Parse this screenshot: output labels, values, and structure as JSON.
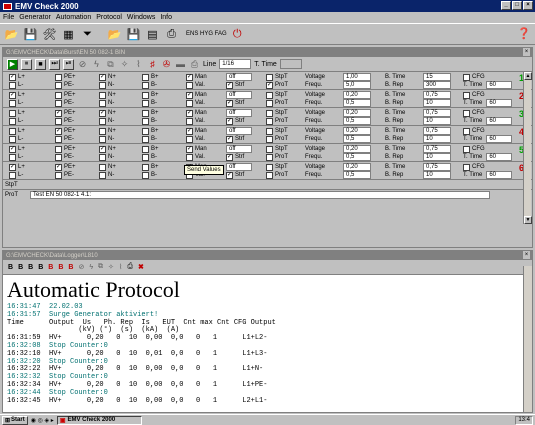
{
  "window": {
    "title": "EMV Check 2000",
    "min": "_",
    "max": "□",
    "close": "×"
  },
  "menu": [
    "File",
    "Generator",
    "Automation",
    "Protocol",
    "Windows",
    "Info"
  ],
  "toolbar": {
    "ins_label": "ENS HYG FAG"
  },
  "panel1": {
    "title": "G:\\EMVCHECK\\Data\\Burst\\EN 50 082-1 BIN",
    "line_label": "Line",
    "line_value": "1/16",
    "ttime_label": "T. Time",
    "rows": [
      {
        "num": "1",
        "num_color": "#00a000",
        "top": {
          "L": "L+",
          "PE": "PE+",
          "N": "N+",
          "B": "B+",
          "mode_lbl": "Man",
          "mode_val": "off",
          "stp": "StpT",
          "v_lbl": "Voltage",
          "v_val": "1,00",
          "bt_lbl": "B. Time",
          "bt_val": "15",
          "cfg": "CFG"
        },
        "bot": {
          "L": "L-",
          "PE": "PE-",
          "N": "N-",
          "B": "B-",
          "val": "Val.",
          "str": "Strf",
          "prot": "ProT",
          "f_lbl": "Frequ.",
          "f_val": "5,0",
          "br_lbl": "B. Rep",
          "br_val": "300",
          "tt_lbl": "T. Time",
          "tt_val": "60"
        },
        "checks": {
          "Lt": true,
          "PEt": false,
          "Nt": true,
          "Bt": false,
          "Man": true,
          "Stp": false,
          "CFG": false,
          "Lb": false,
          "PEb": false,
          "Nb": false,
          "Bb": false,
          "Val": false,
          "Str": true,
          "Prot": true
        }
      },
      {
        "num": "2",
        "num_color": "#c00000",
        "top": {
          "L": "L+",
          "PE": "PE+",
          "N": "N+",
          "B": "B+",
          "mode_lbl": "Man",
          "mode_val": "off",
          "stp": "StpT",
          "v_lbl": "Voltage",
          "v_val": "0,20",
          "bt_lbl": "B. Time",
          "bt_val": "0,75",
          "cfg": "CFG"
        },
        "bot": {
          "L": "L-",
          "PE": "PE-",
          "N": "N-",
          "B": "B-",
          "val": "Val.",
          "str": "Strf",
          "prot": "ProT",
          "f_lbl": "Frequ.",
          "f_val": "0,5",
          "br_lbl": "B. Rep",
          "br_val": "10",
          "tt_lbl": "T. Time",
          "tt_val": "60"
        },
        "checks": {
          "Lt": true,
          "PEt": false,
          "Nt": false,
          "Bt": false,
          "Man": true,
          "Stp": false,
          "CFG": false,
          "Lb": false,
          "PEb": false,
          "Nb": false,
          "Bb": false,
          "Val": false,
          "Str": true,
          "Prot": false
        }
      },
      {
        "num": "3",
        "num_color": "#00a000",
        "top": {
          "L": "L+",
          "PE": "PE+",
          "N": "N+",
          "B": "B+",
          "mode_lbl": "Man",
          "mode_val": "off",
          "stp": "StpT",
          "v_lbl": "Voltage",
          "v_val": "0,20",
          "bt_lbl": "B. Time",
          "bt_val": "0,75",
          "cfg": "CFG"
        },
        "bot": {
          "L": "L-",
          "PE": "PE-",
          "N": "N-",
          "B": "B-",
          "val": "Val.",
          "str": "Strf",
          "prot": "ProT",
          "f_lbl": "Frequ.",
          "f_val": "0,5",
          "br_lbl": "B. Rep",
          "br_val": "10",
          "tt_lbl": "T. Time",
          "tt_val": "60"
        },
        "checks": {
          "Lt": false,
          "PEt": true,
          "Nt": true,
          "Bt": false,
          "Man": true,
          "Stp": false,
          "CFG": false,
          "Lb": false,
          "PEb": false,
          "Nb": false,
          "Bb": false,
          "Val": false,
          "Str": true,
          "Prot": false
        }
      },
      {
        "num": "4",
        "num_color": "#c00000",
        "top": {
          "L": "L+",
          "PE": "PE+",
          "N": "N+",
          "B": "B+",
          "mode_lbl": "Man",
          "mode_val": "off",
          "stp": "StpT",
          "v_lbl": "Voltage",
          "v_val": "0,20",
          "bt_lbl": "B. Time",
          "bt_val": "0,75",
          "cfg": "CFG"
        },
        "bot": {
          "L": "L-",
          "PE": "PE-",
          "N": "N-",
          "B": "B-",
          "val": "Val.",
          "str": "Strf",
          "prot": "ProT",
          "f_lbl": "Frequ.",
          "f_val": "0,5",
          "br_lbl": "B. Rep",
          "br_val": "10",
          "tt_lbl": "T. Time",
          "tt_val": "60"
        },
        "checks": {
          "Lt": false,
          "PEt": true,
          "Nt": false,
          "Bt": false,
          "Man": true,
          "Stp": false,
          "CFG": false,
          "Lb": false,
          "PEb": false,
          "Nb": false,
          "Bb": false,
          "Val": false,
          "Str": true,
          "Prot": false
        }
      },
      {
        "num": "5",
        "num_color": "#00a000",
        "top": {
          "L": "L+",
          "PE": "PE+",
          "N": "N+",
          "B": "B+",
          "mode_lbl": "Man",
          "mode_val": "off",
          "stp": "StpT",
          "v_lbl": "Voltage",
          "v_val": "0,20",
          "bt_lbl": "B. Time",
          "bt_val": "0,75",
          "cfg": "CFG"
        },
        "bot": {
          "L": "L-",
          "PE": "PE-",
          "N": "N-",
          "B": "B-",
          "val": "Val.",
          "str": "Strf",
          "prot": "ProT",
          "f_lbl": "Frequ.",
          "f_val": "0,5",
          "br_lbl": "B. Rep",
          "br_val": "10",
          "tt_lbl": "T. Time",
          "tt_val": "60"
        },
        "checks": {
          "Lt": true,
          "PEt": false,
          "Nt": true,
          "Bt": false,
          "Man": true,
          "Stp": false,
          "CFG": false,
          "Lb": false,
          "PEb": false,
          "Nb": false,
          "Bb": false,
          "Val": false,
          "Str": true,
          "Prot": false
        }
      },
      {
        "num": "6",
        "num_color": "#c00000",
        "top": {
          "L": "L+",
          "PE": "PE+",
          "N": "N+",
          "B": "B+",
          "mode_lbl": "Man",
          "mode_val": "off",
          "stp": "StpT",
          "v_lbl": "Voltage",
          "v_val": "0,20",
          "bt_lbl": "B. Time",
          "bt_val": "0,75",
          "cfg": "CFG"
        },
        "bot": {
          "L": "L-",
          "PE": "PE-",
          "N": "N-",
          "B": "B-",
          "val": "Val.",
          "str": "Strf",
          "prot": "ProT",
          "f_lbl": "Frequ.",
          "f_val": "0,5",
          "br_lbl": "B. Rep",
          "br_val": "10",
          "tt_lbl": "T. Time",
          "tt_val": "60"
        },
        "checks": {
          "Lt": true,
          "PEt": true,
          "Nt": false,
          "Bt": false,
          "Man": true,
          "Stp": false,
          "CFG": false,
          "Lb": false,
          "PEb": false,
          "Nb": false,
          "Bb": false,
          "Val": false,
          "Str": true,
          "Prot": false
        }
      }
    ],
    "stpt_label": "StpT",
    "prot_label": "ProT",
    "prot_value": "Test EN 50 082-1 4.1:",
    "tooltip": "Send Values"
  },
  "panel2": {
    "title": "G:\\EMVCHECK\\Data\\Logger\\L810",
    "toolbar": [
      "B",
      "B",
      "B",
      "B",
      "B",
      "B",
      "B"
    ],
    "heading": "Automatic Protocol",
    "lines": [
      {
        "t": "16:31:47  22.02.03",
        "teal": true
      },
      {
        "t": "16:31:57  Surge Generator aktiviert!",
        "teal": true
      },
      {
        "t": "Time      Output  Us   Ph. Rep  Is   EUT  Cnt max Cnt CFG Output",
        "teal": false
      },
      {
        "t": "                 (kV) (°)  (s)  (kA)  (A)",
        "teal": false
      },
      {
        "t": "16:31:59  HV+      0,20   0  10  0,00  0,0   0   1      L1+L2-",
        "teal": false
      },
      {
        "t": "16:32:08  Stop Counter:0",
        "teal": true
      },
      {
        "t": "16:32:10  HV+      0,20   0  10  0,01  0,0   0   1      L1+L3-",
        "teal": false
      },
      {
        "t": "16:32:20  Stop Counter:0",
        "teal": true
      },
      {
        "t": "16:32:22  HV+      0,20   0  10  0,00  0,0   0   1      L1+N-",
        "teal": false
      },
      {
        "t": "16:32:32  Stop Counter:0",
        "teal": true
      },
      {
        "t": "16:32:34  HV+      0,20   0  10  0,00  0,0   0   1      L1+PE-",
        "teal": false
      },
      {
        "t": "16:32:44  Stop Counter:0",
        "teal": true
      },
      {
        "t": "16:32:45  HV+      0,20   0  10  0,00  0,0   0   1      L2+L1-",
        "teal": false
      }
    ]
  },
  "taskbar": {
    "start": "Start",
    "task": "EMV Check 2000",
    "clock": "13:4"
  }
}
